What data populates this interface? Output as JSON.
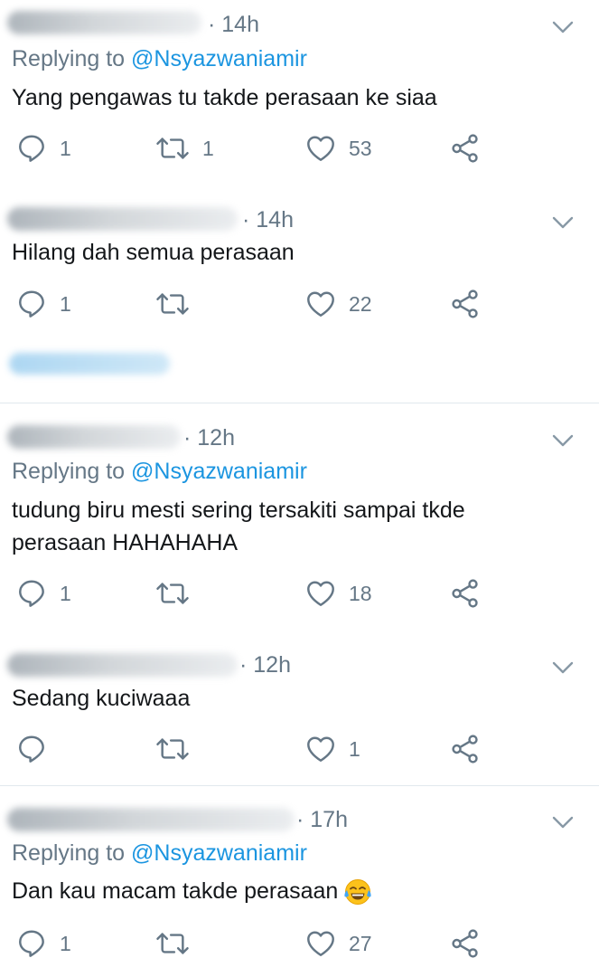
{
  "tweets": [
    {
      "time": "14h",
      "replying_prefix": "Replying to",
      "replying_handle": "@Nsyazwaniamir",
      "text": "Yang pengawas tu takde perasaan ke siaa",
      "replies": "1",
      "retweets": "1",
      "likes": "53"
    },
    {
      "time": "14h",
      "text": "Hilang dah semua perasaan",
      "replies": "1",
      "retweets": "",
      "likes": "22"
    },
    {
      "time": "12h",
      "replying_prefix": "Replying to",
      "replying_handle": "@Nsyazwaniamir",
      "text_line1": "tudung biru mesti sering tersakiti sampai tkde",
      "text_line2": "perasaan HAHAHAHA",
      "replies": "1",
      "retweets": "",
      "likes": "18"
    },
    {
      "time": "12h",
      "text": "Sedang kuciwaaa",
      "replies": "",
      "retweets": "",
      "likes": "1"
    },
    {
      "time": "17h",
      "replying_prefix": "Replying to",
      "replying_handle": "@Nsyazwaniamir",
      "text": "Dan kau macam takde perasaan",
      "emoji": "face-with-tears-of-joy",
      "replies": "1",
      "retweets": "",
      "likes": "27"
    }
  ],
  "icons": {
    "reply": "reply-bubble-icon",
    "retweet": "retweet-icon",
    "like": "heart-icon",
    "share": "share-icon",
    "more": "chevron-down-icon"
  },
  "colors": {
    "text": "#14171a",
    "secondary": "#657786",
    "link": "#1b95e0",
    "divider": "#e1e8ed"
  }
}
